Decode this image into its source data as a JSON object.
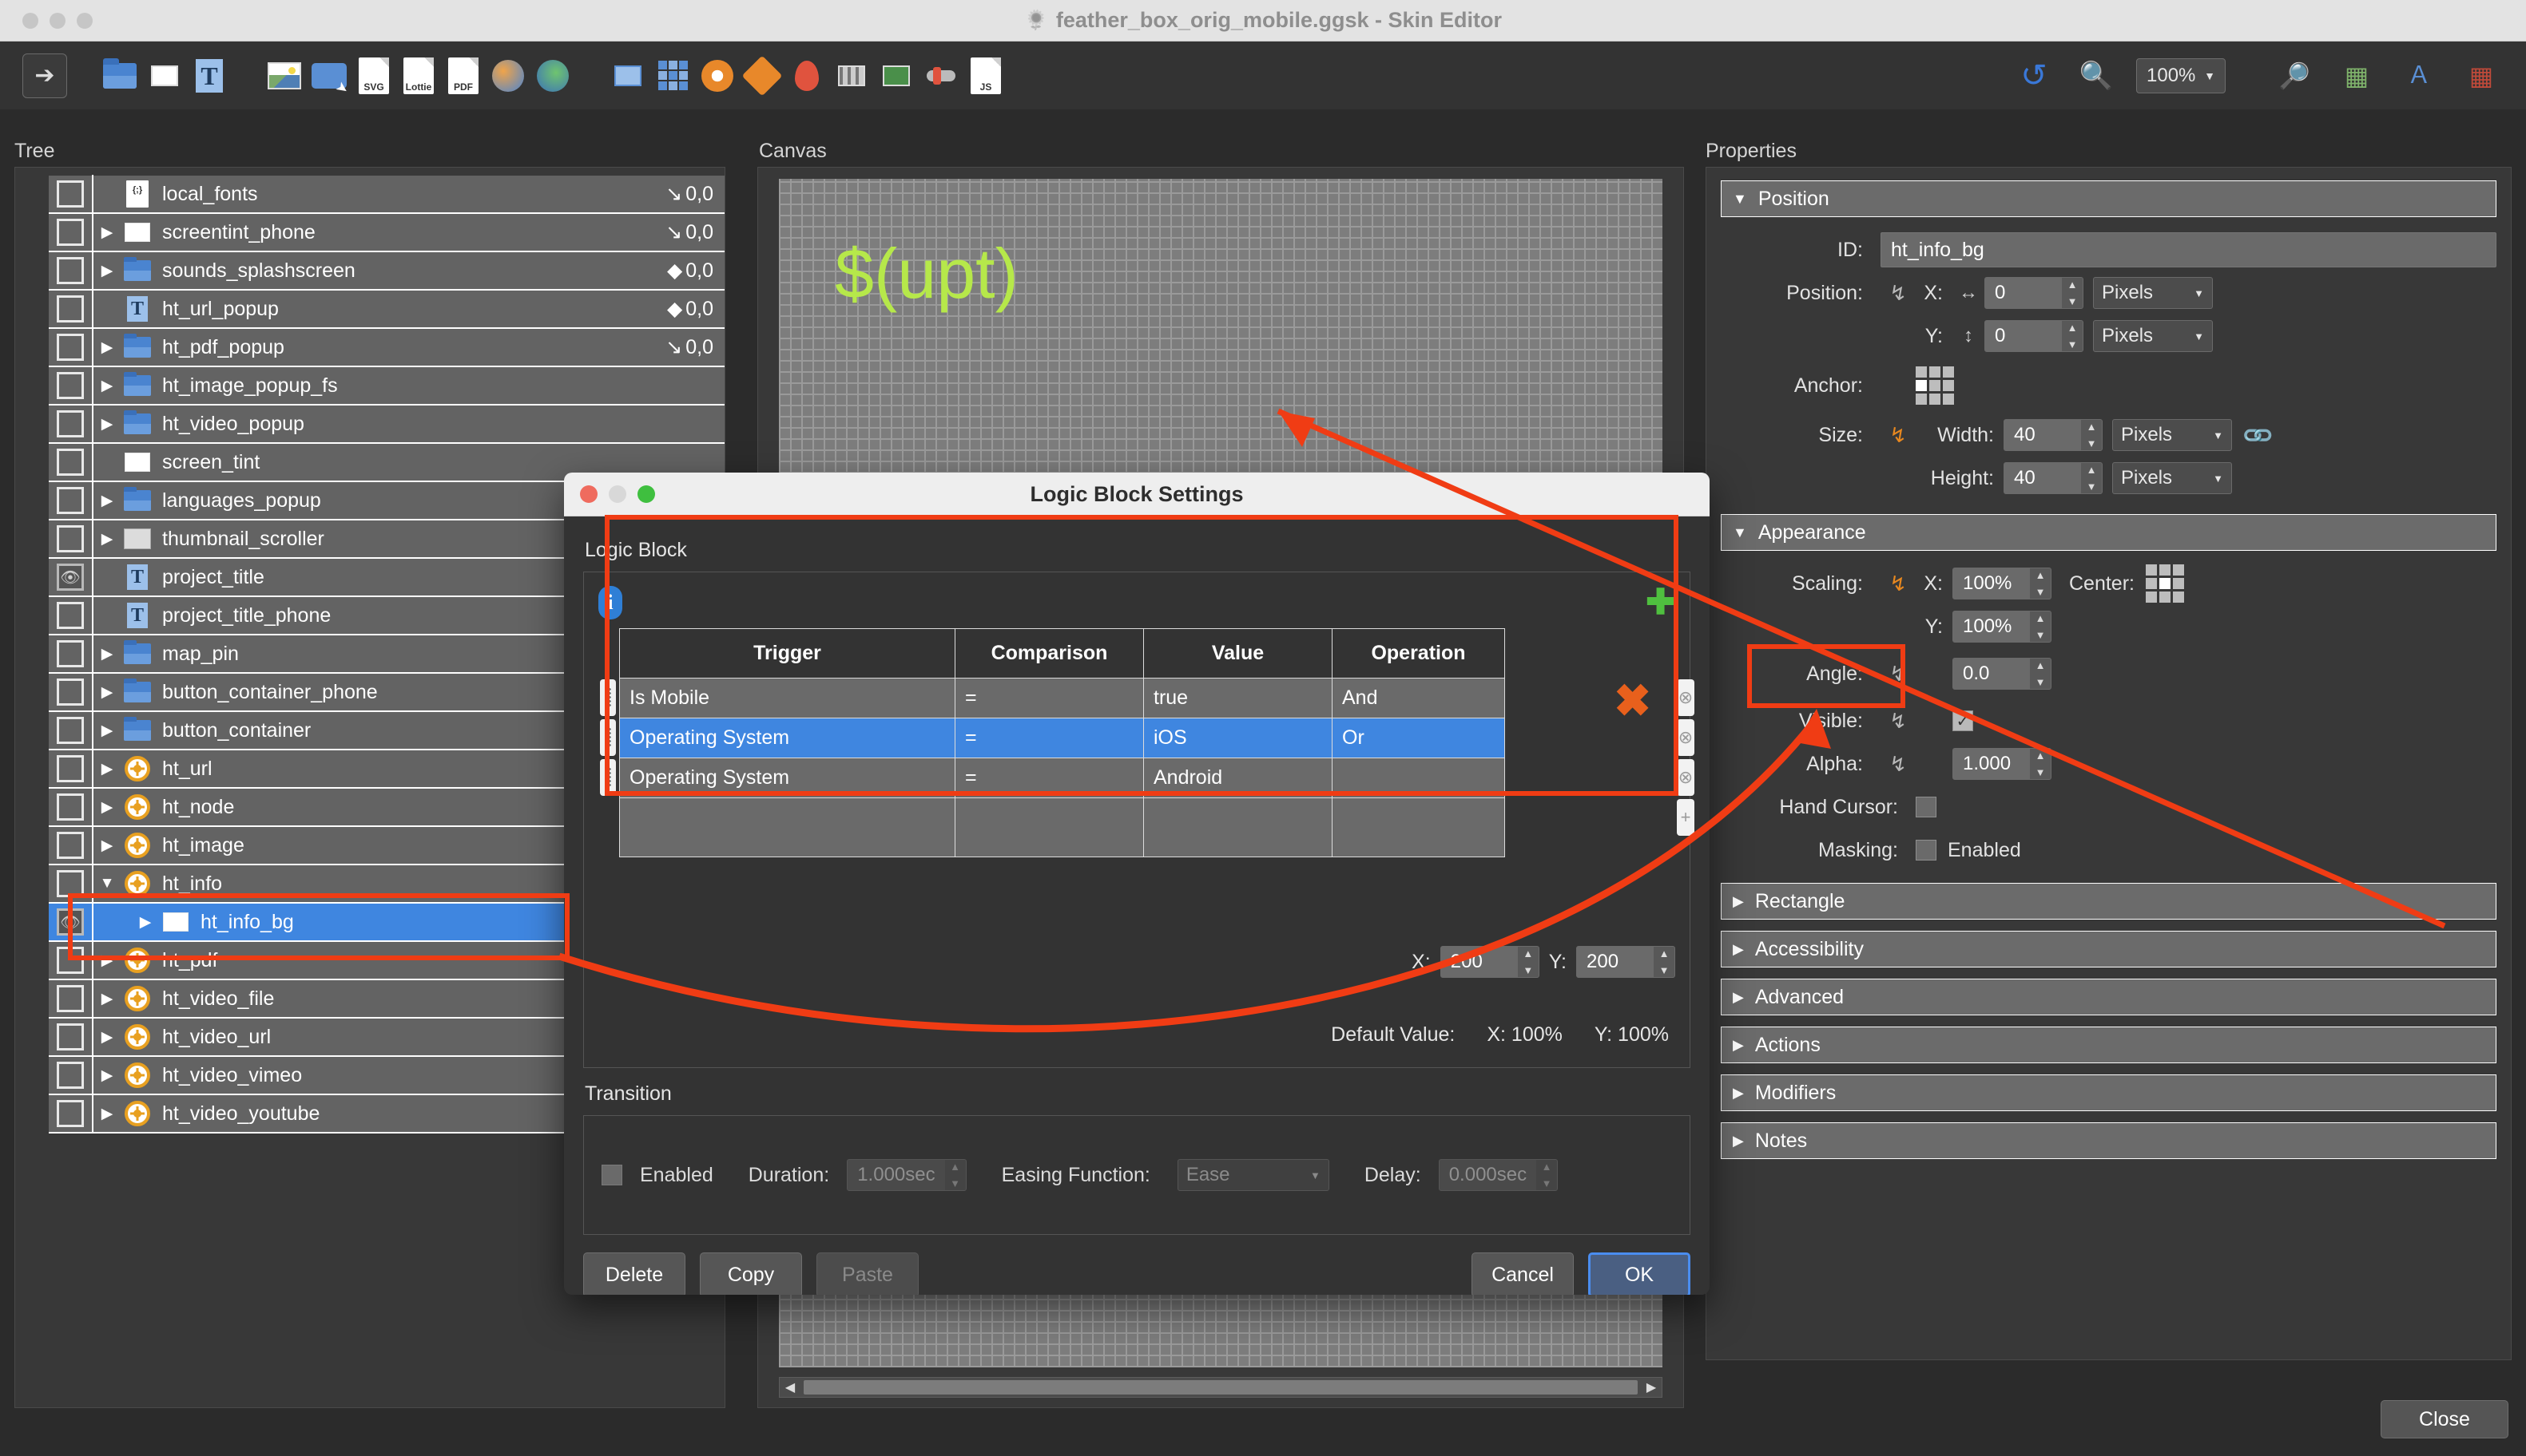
{
  "window": {
    "title": "feather_box_orig_mobile.ggsk - Skin Editor",
    "app_icon": "feather-icon",
    "lights": [
      "minimize",
      "zoom",
      "close"
    ]
  },
  "toolbar": {
    "zoom_value": "100%",
    "items": [
      {
        "name": "select-tool",
        "icon": "arrow-cursor-icon",
        "selected": true
      },
      {
        "name": "folder-tool",
        "icon": "folder-icon"
      },
      {
        "name": "rectangle-tool",
        "icon": "rectangle-icon"
      },
      {
        "name": "text-tool",
        "icon": "text-T-icon"
      },
      {
        "name": "image-tool",
        "icon": "image-icon"
      },
      {
        "name": "button-tool",
        "icon": "button-cursor-icon"
      },
      {
        "name": "svg-tool",
        "icon": "svg-file-icon",
        "label": "SVG"
      },
      {
        "name": "lottie-tool",
        "icon": "lottie-file-icon",
        "label": "Lottie"
      },
      {
        "name": "pdf-tool",
        "icon": "pdf-file-icon",
        "label": "PDF"
      },
      {
        "name": "globe-tool",
        "icon": "globe-icon"
      },
      {
        "name": "map-tool",
        "icon": "map-icon"
      },
      {
        "name": "screen-tool",
        "icon": "monitor-icon"
      },
      {
        "name": "grid-tool",
        "icon": "grid-icon"
      },
      {
        "name": "compass-tool",
        "icon": "compass-icon"
      },
      {
        "name": "hotspot-tool",
        "icon": "hotspot-icon"
      },
      {
        "name": "pin-tool",
        "icon": "map-pin-icon"
      },
      {
        "name": "filmstrip-tool",
        "icon": "filmstrip-icon"
      },
      {
        "name": "video-tool",
        "icon": "video-icon"
      },
      {
        "name": "slider-tool",
        "icon": "slider-icon"
      },
      {
        "name": "script-tool",
        "icon": "js-file-icon"
      }
    ],
    "right_items": [
      {
        "name": "undo-button",
        "icon": "undo-arrow-icon"
      },
      {
        "name": "preview-button",
        "icon": "magnifier-icon"
      },
      {
        "name": "zoom-select",
        "icon": "chevron-down-icon"
      },
      {
        "name": "inspect-button",
        "icon": "inspect-icon"
      },
      {
        "name": "layers-button",
        "icon": "layers-icon"
      },
      {
        "name": "translate-button",
        "icon": "translate-icon"
      },
      {
        "name": "export-button",
        "icon": "export-icon"
      }
    ]
  },
  "panels": {
    "tree_label": "Tree",
    "canvas_label": "Canvas",
    "properties_label": "Properties"
  },
  "tree": {
    "rows": [
      {
        "label": "local_fonts",
        "icon": "js-file-icon",
        "arrow": "none",
        "indent": 0,
        "coord": "0,0",
        "marker": "arrow",
        "check": true
      },
      {
        "label": "screentint_phone",
        "icon": "rect-icon",
        "arrow": "closed",
        "indent": 0,
        "coord": "0,0",
        "marker": "arrow",
        "check": true
      },
      {
        "label": "sounds_splashscreen",
        "icon": "folder-icon",
        "arrow": "closed",
        "indent": 0,
        "coord": "0,0",
        "marker": "diamond",
        "check": true
      },
      {
        "label": "ht_url_popup",
        "icon": "text-icon",
        "arrow": "none",
        "indent": 0,
        "coord": "0,0",
        "marker": "diamond",
        "check": true
      },
      {
        "label": "ht_pdf_popup",
        "icon": "folder-icon",
        "arrow": "closed",
        "indent": 0,
        "coord": "0,0",
        "marker": "arrow",
        "check": true
      },
      {
        "label": "ht_image_popup_fs",
        "icon": "folder-icon",
        "arrow": "closed",
        "indent": 0,
        "coord": "",
        "marker": "",
        "check": true
      },
      {
        "label": "ht_video_popup",
        "icon": "folder-icon",
        "arrow": "closed",
        "indent": 0,
        "coord": "",
        "marker": "",
        "check": true
      },
      {
        "label": "screen_tint",
        "icon": "rect-icon",
        "arrow": "none",
        "indent": 0,
        "coord": "",
        "marker": "",
        "check": true
      },
      {
        "label": "languages_popup",
        "icon": "folder-icon",
        "arrow": "closed",
        "indent": 0,
        "coord": "",
        "marker": "",
        "check": true
      },
      {
        "label": "thumbnail_scroller",
        "icon": "thumb-icon",
        "arrow": "closed",
        "indent": 0,
        "coord": "",
        "marker": "",
        "check": true
      },
      {
        "label": "project_title",
        "icon": "text-icon",
        "arrow": "none",
        "indent": 0,
        "coord": "",
        "marker": "",
        "check": "eye"
      },
      {
        "label": "project_title_phone",
        "icon": "text-icon",
        "arrow": "none",
        "indent": 0,
        "coord": "",
        "marker": "",
        "check": true
      },
      {
        "label": "map_pin",
        "icon": "folder-icon",
        "arrow": "closed",
        "indent": 0,
        "coord": "",
        "marker": "",
        "check": true
      },
      {
        "label": "button_container_phone",
        "icon": "folder-icon",
        "arrow": "closed",
        "indent": 0,
        "coord": "",
        "marker": "",
        "check": true
      },
      {
        "label": "button_container",
        "icon": "folder-icon",
        "arrow": "closed",
        "indent": 0,
        "coord": "",
        "marker": "",
        "check": true
      },
      {
        "label": "ht_url",
        "icon": "node-icon",
        "arrow": "closed",
        "indent": 0,
        "coord": "",
        "marker": "",
        "check": true
      },
      {
        "label": "ht_node",
        "icon": "node-icon",
        "arrow": "closed",
        "indent": 0,
        "coord": "",
        "marker": "",
        "check": true
      },
      {
        "label": "ht_image",
        "icon": "node-icon",
        "arrow": "closed",
        "indent": 0,
        "coord": "",
        "marker": "",
        "check": true
      },
      {
        "label": "ht_info",
        "icon": "node-icon",
        "arrow": "open",
        "indent": 0,
        "coord": "",
        "marker": "",
        "check": true
      },
      {
        "label": "ht_info_bg",
        "icon": "rect-icon",
        "arrow": "closed",
        "indent": 1,
        "coord": "",
        "marker": "",
        "check": "eye",
        "selected": true,
        "highlighted": true
      },
      {
        "label": "ht_pdf",
        "icon": "node-icon",
        "arrow": "closed",
        "indent": 0,
        "coord": "",
        "marker": "",
        "check": true
      },
      {
        "label": "ht_video_file",
        "icon": "node-icon",
        "arrow": "closed",
        "indent": 0,
        "coord": "",
        "marker": "",
        "check": true
      },
      {
        "label": "ht_video_url",
        "icon": "node-icon",
        "arrow": "closed",
        "indent": 0,
        "coord": "",
        "marker": "",
        "check": true
      },
      {
        "label": "ht_video_vimeo",
        "icon": "node-icon",
        "arrow": "closed",
        "indent": 0,
        "coord": "",
        "marker": "",
        "check": true
      },
      {
        "label": "ht_video_youtube",
        "icon": "node-icon",
        "arrow": "closed",
        "indent": 0,
        "coord": "",
        "marker": "",
        "check": true
      }
    ]
  },
  "canvas": {
    "text": "$(upt)"
  },
  "properties": {
    "position": {
      "section_label": "Position",
      "expanded": true,
      "id_label": "ID:",
      "id_value": "ht_info_bg",
      "position_label": "Position:",
      "x_label": "X:",
      "x_value": "0",
      "x_unit": "Pixels",
      "y_label": "Y:",
      "y_value": "0",
      "y_unit": "Pixels",
      "anchor_label": "Anchor:",
      "size_label": "Size:",
      "width_label": "Width:",
      "width_value": "40",
      "width_unit": "Pixels",
      "height_label": "Height:",
      "height_value": "40",
      "height_unit": "Pixels"
    },
    "appearance": {
      "section_label": "Appearance",
      "expanded": true,
      "scaling_label": "Scaling:",
      "scale_x_label": "X:",
      "scale_x_value": "100%",
      "scale_y_label": "Y:",
      "scale_y_value": "100%",
      "center_label": "Center:",
      "angle_label": "Angle:",
      "angle_value": "0.0",
      "visible_label": "Visible:",
      "visible_checked": true,
      "alpha_label": "Alpha:",
      "alpha_value": "1.000",
      "hand_cursor_label": "Hand Cursor:",
      "hand_cursor_checked": false,
      "masking_label": "Masking:",
      "masking_checkbox_label": "Enabled",
      "masking_checked": false
    },
    "collapsed_sections": [
      "Rectangle",
      "Accessibility",
      "Advanced",
      "Actions",
      "Modifiers",
      "Notes"
    ],
    "close_button": "Close"
  },
  "dialog": {
    "title": "Logic Block Settings",
    "logic_block_label": "Logic Block",
    "info_icon": "info-icon",
    "add_icon": "plus-icon",
    "delete_all_icon": "x-icon",
    "table": {
      "headers": [
        "Trigger",
        "Comparison",
        "Value",
        "Operation"
      ],
      "rows": [
        {
          "trigger": "Is Mobile",
          "comparison": "=",
          "value": "true",
          "operation": "And",
          "selected": false
        },
        {
          "trigger": "Operating System",
          "comparison": "=",
          "value": "iOS",
          "operation": "Or",
          "selected": true
        },
        {
          "trigger": "Operating System",
          "comparison": "=",
          "value": "Android",
          "operation": "",
          "selected": false
        },
        {
          "trigger": "",
          "comparison": "",
          "value": "",
          "operation": "",
          "selected": false
        }
      ]
    },
    "xy": {
      "x_label": "X:",
      "x_value": "200",
      "y_label": "Y:",
      "y_value": "200"
    },
    "default_value": {
      "label": "Default Value:",
      "x": "X: 100%",
      "y": "Y: 100%"
    },
    "transition": {
      "section_label": "Transition",
      "enabled_label": "Enabled",
      "enabled_checked": false,
      "duration_label": "Duration:",
      "duration_value": "1.000sec",
      "easing_label": "Easing Function:",
      "easing_value": "Ease",
      "delay_label": "Delay:",
      "delay_value": "0.000sec"
    },
    "buttons": {
      "delete": "Delete",
      "copy": "Copy",
      "paste": "Paste",
      "cancel": "Cancel",
      "ok": "OK"
    }
  },
  "annotations": {
    "color": "#f03c14",
    "boxes": [
      "logic-table-highlight",
      "tree-ht-info-bg-highlight",
      "scaling-label-highlight"
    ],
    "arrows": [
      "dialog-title-arrow",
      "scaling-curve-arrow"
    ]
  }
}
